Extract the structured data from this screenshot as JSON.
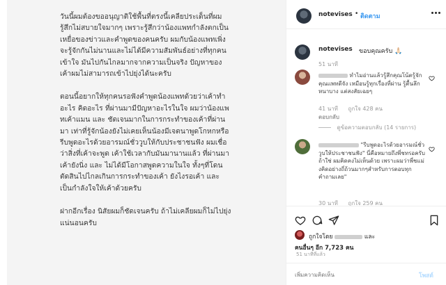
{
  "post": {
    "paragraphs": [
      "วันนี้ผมต้องขออนุญาติใช้พื้นที่ตรงนี้เคลียประเด็นที่ผมรู้สึกไม่สบายใจมากๆ เพราะรู้สึกว่าน้องแพทกำลังตกเป็นเหยื่อของข่าวและคำพูดของคนครับ ผมกับน้องแพทเพิ่งจะรู้จักกันไม่นานและไม่ได้มีความสัมพันธ์อย่างที่ทุกคนเข้าใจ มันไปกันไกลมากจากความเป็นจริง ปัญหาของเค้าผมไม่สามารถเข้าไปยุ่งได้นะครับ",
      "ตอนนี้อยากให้ทุกคนรอฟังคำพูดน้องแพทด้วยว่าเค้าทำอะไร คิดอะไร ที่ผ่านมามีปัญหาอะไรในใจ ผมว่าน้องแพทเค้าแมน และ ชัดเจนมากในการกระทำของเค้าที่ผ่านมา เท่าที่รู้จักน้องยังไม่เคยเห็นน้องมีเจตนาพูดโกหกหรือรีบพูดอะไรด้วยอารมณ์ชั่ววูบให้กับประชาชนฟัง ผมเชื่อว่าสิ่งที่เค้าจะพูด เค้าใช้เวลากับมันมานานแล้ว ที่ผ่านมาเค้ายังนิ่ง และ ไม่ได้มีโอกาสพูดความในใจ ทั้งๆที่โดนตัดสินไปไกลเกินการกระทำของเค้า ยังไงรอเค้า และ เป็นกำลังใจให้เค้าด้วยครับ",
      "ฝากอีกเรื่อง นิสัยผมก็ชัดเจนครับ ถ้าไม่เคลียผมก็ไม่ไปยุ่งแน่นอนครับ"
    ]
  },
  "header": {
    "username": "notevises",
    "dot": "•",
    "follow_label": "ติดตาม"
  },
  "caption": {
    "username": "notevises",
    "text": "ขอบคุณครับ 🙏🏻",
    "time": "51 นาที"
  },
  "comments": [
    {
      "username_blurred": "...",
      "text": "ทำไมอ่านแล้วรู้สึกคุณโน้ตรู้จักคุณแพทดีจัง เหมือนรู้ทุกเรื่องที่ผ่าน รู้ตื้นลึกหนาบาง แต่สงสัยเฉยๆ",
      "time": "41 นาที",
      "likes": "ถูกใจ 428 คน",
      "reply": "ตอบกลับ",
      "replies_label": "ดูข้อความตอบกลับ (14 รายการ)"
    },
    {
      "username_blurred": "...",
      "text": "\"รีบพูดอะไรด้วยอารมณ์ชั่ววูบให้ประชาชนฟัง\" นี่คือหมายถึงพี่ชทรอครับ ถ้าใช่ ผมคิดคงไม่เห็นด้วย เพราะผมว่าพี่ชแม่งคิดอย่างถี่ถ้วนมากๆสำหรับการตอบทุกคำถามเลย\"",
      "time": "30 นาที",
      "likes": "ถูกใจ 259 คน"
    }
  ],
  "actions": {
    "liked_by_prefix": "ถูกใจโดย",
    "liked_by_and": "และ",
    "liked_by_others": "คนอื่นๆ อีก 7,723 คน",
    "post_time": "51 นาทีที่แล้ว"
  },
  "comment_box": {
    "placeholder": "เพิ่มความคิดเห็น",
    "post_label": "โพสต์"
  },
  "colors": {
    "link_blue": "#3897f0",
    "muted_gray": "#999999",
    "panel_gray": "#f4f4f4"
  },
  "icons": [
    "more-icon",
    "heart-icon",
    "comment-icon",
    "share-icon",
    "bookmark-icon"
  ]
}
